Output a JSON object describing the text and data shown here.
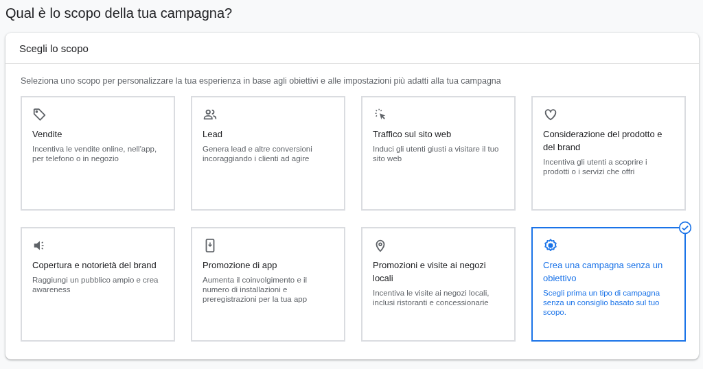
{
  "page_title": "Qual è lo scopo della tua campagna?",
  "panel": {
    "title": "Scegli lo scopo",
    "description": "Seleziona uno scopo per personalizzare la tua esperienza in base agli obiettivi e alle impostazioni più adatti alla tua campagna"
  },
  "goals": [
    {
      "kind": "tag",
      "title": "Vendite",
      "description": "Incentiva le vendite online, nell'app, per telefono o in negozio",
      "selected": false
    },
    {
      "kind": "people",
      "title": "Lead",
      "description": "Genera lead e altre conversioni incoraggiando i clienti ad agire",
      "selected": false
    },
    {
      "kind": "cursor",
      "title": "Traffico sul sito web",
      "description": "Induci gli utenti giusti a visitare il tuo sito web",
      "selected": false
    },
    {
      "kind": "heart",
      "title": "Considerazione del prodotto e del brand",
      "description": "Incentiva gli utenti a scoprire i prodotti o i servizi che offri",
      "selected": false
    },
    {
      "kind": "speaker",
      "title": "Copertura e notorietà del brand",
      "description": "Raggiungi un pubblico ampio e crea awareness",
      "selected": false
    },
    {
      "kind": "phone",
      "title": "Promozione di app",
      "description": "Aumenta il coinvolgimento e il numero di installazioni e preregistrazioni per la tua app",
      "selected": false
    },
    {
      "kind": "pin",
      "title": "Promozioni e visite ai negozi locali",
      "description": "Incentiva le visite ai negozi locali, inclusi ristoranti e concessionarie",
      "selected": false
    },
    {
      "kind": "gear",
      "title": "Crea una campagna senza un obiettivo",
      "description": "Scegli prima un tipo di campagna senza un consiglio basato sul tuo scopo.",
      "selected": true
    }
  ]
}
